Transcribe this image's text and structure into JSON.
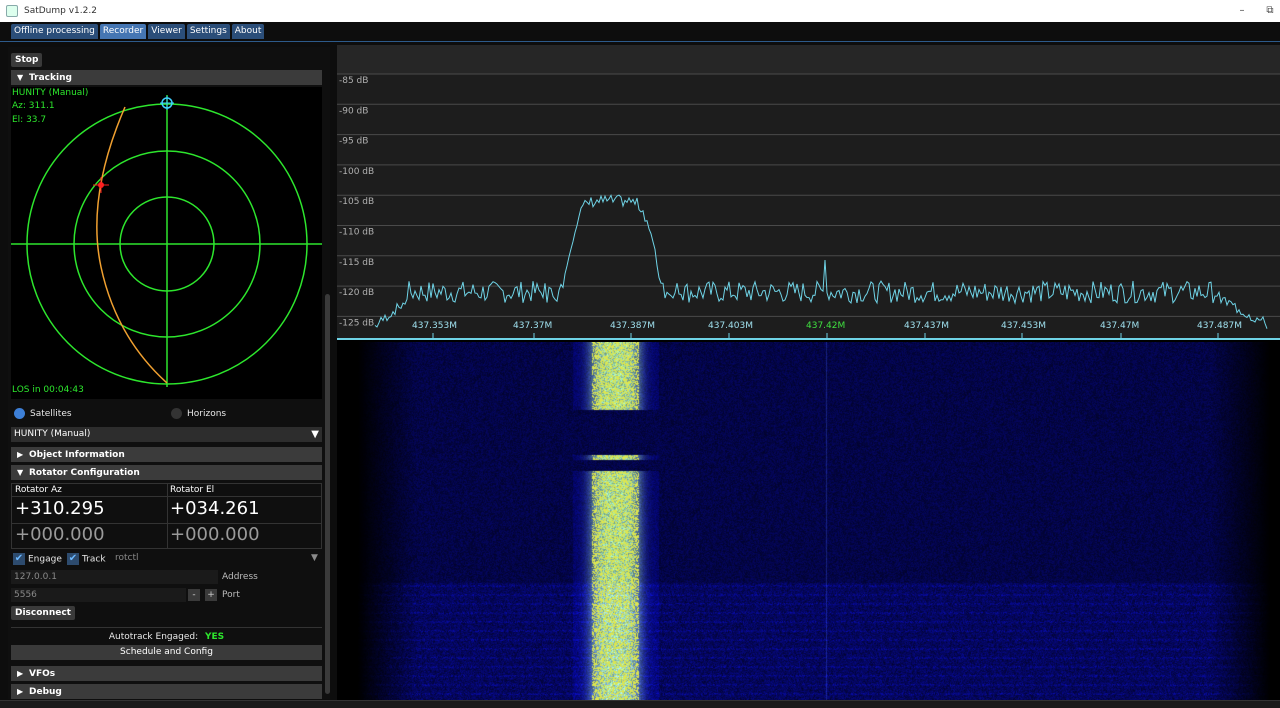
{
  "window": {
    "title": "SatDump v1.2.2",
    "minimize": "–",
    "restore": "⧉"
  },
  "menu": {
    "tabs": [
      "Offline processing",
      "Recorder",
      "Viewer",
      "Settings",
      "About"
    ],
    "active": "Recorder"
  },
  "left": {
    "stop_label": "Stop",
    "tracking_header": "Tracking",
    "polar": {
      "sat_name": "HUNITY (Manual)",
      "az": "Az: 311.1",
      "el": "El: 33.7",
      "los": "LOS in 00:04:43"
    },
    "satellites_label": "Satellites",
    "horizons_label": "Horizons",
    "satellite_select": "HUNITY (Manual)",
    "object_info_header": "Object Information",
    "rotator_header": "Rotator Configuration",
    "rotator_az_label": "Rotator Az",
    "rotator_el_label": "Rotator El",
    "rotator_az_value": "+310.295",
    "rotator_el_value": "+034.261",
    "rotator_az_target": "+000.000",
    "rotator_el_target": "+000.000",
    "engage_label": "Engage",
    "track_label": "Track",
    "rotator_type": "rotctl",
    "address_value": "127.0.0.1",
    "address_label": "Address",
    "port_value": "5556",
    "port_minus": "-",
    "port_plus": "+",
    "port_label": "Port",
    "disconnect_label": "Disconnect",
    "autotrack_label": "Autotrack Engaged:",
    "autotrack_value": "YES",
    "schedule_label": "Schedule and Config",
    "vfos_header": "VFOs",
    "debug_header": "Debug"
  },
  "fft": {
    "db_labels": [
      "-85 dB",
      "-90 dB",
      "-95 dB",
      "-100 dB",
      "-105 dB",
      "-110 dB",
      "-115 dB",
      "-120 dB",
      "-125 dB"
    ],
    "freq_labels": [
      "437.353M",
      "437.37M",
      "437.387M",
      "437.403M",
      "437.42M",
      "437.437M",
      "437.453M",
      "437.47M",
      "437.487M"
    ],
    "center_freq": "437.42M",
    "colors": {
      "trace": "#6fd3e6",
      "center": "#40e040",
      "grid": "#4a4a4a",
      "waterfall_bg": "#0a0a4a"
    }
  }
}
